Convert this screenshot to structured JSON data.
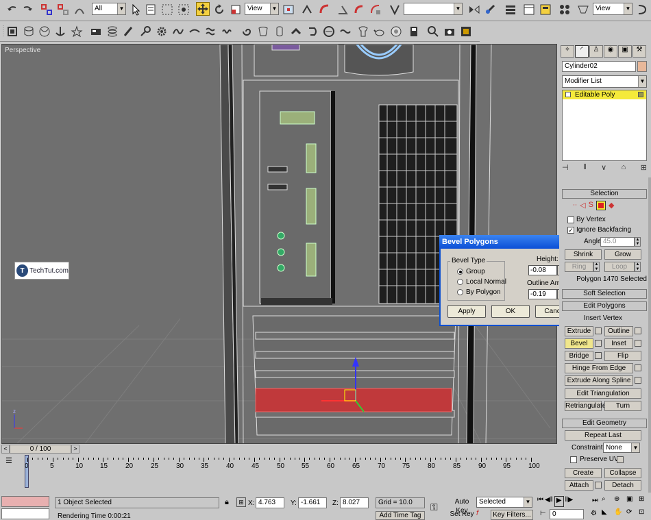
{
  "toolbar": {
    "selection_filter": "All",
    "ref_coord_left": "View",
    "named_selection": "",
    "ref_coord_right": "View"
  },
  "viewport": {
    "label": "Perspective",
    "watermark": "TechTut.com"
  },
  "command_panel": {
    "object_name": "Cylinder02",
    "modifier_list": "Modifier List",
    "stack_item": "Editable Poly",
    "selection": {
      "header": "Selection",
      "by_vertex": "By Vertex",
      "ignore_backfacing": "Ignore Backfacing",
      "ignore_backfacing_checked": true,
      "angle_label": "Angle:",
      "angle_value": "45.0",
      "shrink": "Shrink",
      "grow": "Grow",
      "ring": "Ring",
      "loop": "Loop",
      "status": "Polygon 1470 Selected"
    },
    "soft_selection": "Soft Selection",
    "edit_polygons": {
      "header": "Edit Polygons",
      "insert_vertex": "Insert Vertex",
      "extrude": "Extrude",
      "outline": "Outline",
      "bevel": "Bevel",
      "inset": "Inset",
      "bridge": "Bridge",
      "flip": "Flip",
      "hinge_from_edge": "Hinge From Edge",
      "extrude_along_spline": "Extrude Along Spline",
      "edit_triangulation": "Edit Triangulation",
      "retriangulate": "Retriangulate",
      "turn": "Turn"
    },
    "edit_geometry": {
      "header": "Edit Geometry",
      "repeat_last": "Repeat Last",
      "constraints_label": "Constraints:",
      "constraints_value": "None",
      "preserve_uvs": "Preserve UVs",
      "create": "Create",
      "collapse": "Collapse",
      "attach": "Attach",
      "detach": "Detach"
    }
  },
  "dialog": {
    "title": "Bevel Polygons",
    "bevel_type_label": "Bevel Type",
    "options": [
      "Group",
      "Local Normal",
      "By Polygon"
    ],
    "selected_option": "Group",
    "height_label": "Height:",
    "height_value": "-0.08",
    "outline_label": "Outline Amount:",
    "outline_value": "-0.19",
    "apply": "Apply",
    "ok": "OK",
    "cancel": "Cancel"
  },
  "timeline": {
    "frame_display": "0 / 100",
    "ticks": [
      "0",
      "5",
      "10",
      "15",
      "20",
      "25",
      "30",
      "35",
      "40",
      "45",
      "50",
      "55",
      "60",
      "65",
      "70",
      "75",
      "80",
      "85",
      "90",
      "95",
      "100"
    ]
  },
  "status_bar": {
    "selection_info": "1 Object Selected",
    "prompt": "Rendering Time  0:00:21",
    "x_label": "X:",
    "x_value": "4.763",
    "y_label": "Y:",
    "y_value": "-1.661",
    "z_label": "Z:",
    "z_value": "8.027",
    "grid": "Grid = 10.0",
    "add_time_tag": "Add Time Tag",
    "auto_key": "Auto Key",
    "set_key": "Set Key",
    "key_mode": "Selected",
    "key_filters": "Key Filters...",
    "frame": "0"
  },
  "colors": {
    "viewport_bg": "#6f6f6f",
    "selection_red": "#c0393b",
    "panel_bg": "#c8c8c8",
    "dialog_title": "#0c4fd6",
    "stack_yellow": "#f5ea3a"
  }
}
